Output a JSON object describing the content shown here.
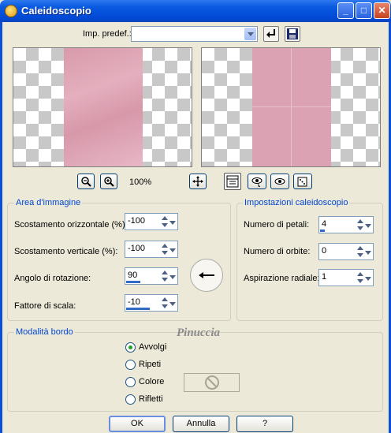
{
  "window": {
    "title": "Caleidoscopio"
  },
  "toolbar": {
    "preset_label": "Imp. predef.:",
    "preset_value": ""
  },
  "preview": {
    "zoom": "100%"
  },
  "image_area": {
    "title": "Area d'immagine",
    "h_offset_label": "Scostamento orizzontale (%):",
    "h_offset_value": "-100",
    "v_offset_label": "Scostamento verticale (%):",
    "v_offset_value": "-100",
    "rotation_label": "Angolo di rotazione:",
    "rotation_value": "90",
    "scale_label": "Fattore di scala:",
    "scale_value": "-10"
  },
  "kaleido_settings": {
    "title": "Impostazioni caleidoscopio",
    "petals_label": "Numero di petali:",
    "petals_value": "4",
    "orbits_label": "Numero di orbite:",
    "orbits_value": "0",
    "radial_label": "Aspirazione radiale:",
    "radial_value": "1"
  },
  "edge_mode": {
    "title": "Modalità bordo",
    "options": [
      "Avvolgi",
      "Ripeti",
      "Colore",
      "Rifletti"
    ],
    "selected": "Avvolgi"
  },
  "watermark": "Pinuccia",
  "buttons": {
    "ok": "OK",
    "cancel": "Annulla",
    "help": "?"
  }
}
